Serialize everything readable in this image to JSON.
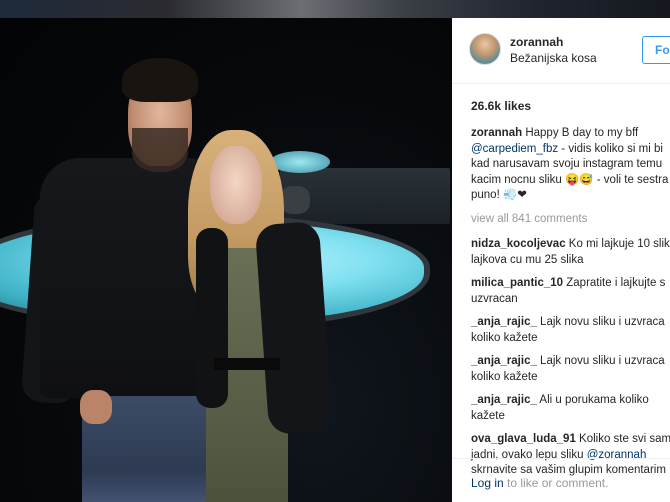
{
  "post": {
    "username": "zorannah",
    "location": "Bežanijska kosa",
    "follow_label": "Fo",
    "likes": "26.6k likes"
  },
  "caption": {
    "username": "zorannah",
    "text_1": "Happy B day to my bff",
    "mention": "@carpediem_fbz",
    "text_2": " - vidis koliko si mi bi\nkad narusavam svoju instagram temu\nkacim nocnu sliku 😝😅 - voli te sestra\npuno! 💨❤"
  },
  "view_all": "view all 841 comments",
  "comments": [
    {
      "user": "nidza_kocoljevac",
      "text": " Ko mi lajkuje 10 slik\nlajkova cu mu 25 slika"
    },
    {
      "user": "milica_pantic_10",
      "text": " Zapratite i lajkujte s\nuzvracan"
    },
    {
      "user": "_anja_rajic_",
      "text": " Lajk novu sliku i uzvraca\nkoliko kažete"
    },
    {
      "user": "_anja_rajic_",
      "text": " Lajk novu sliku i uzvraca\nkoliko kažete"
    },
    {
      "user": "_anja_rajic_",
      "text": " Ali u porukama koliko\nkažete"
    }
  ],
  "last_comment": {
    "user": "ova_glava_luda_91",
    "text_1": " Koliko ste svi sam\njadni, ovako lepu sliku ",
    "mention": "@zorannah",
    "text_2": "\nskrnavite sa vašim glupim komentarim"
  },
  "footer": {
    "login_link": "Log in",
    "login_rest": " to like or comment."
  },
  "icons": {
    "avatar": "profile-photo"
  }
}
